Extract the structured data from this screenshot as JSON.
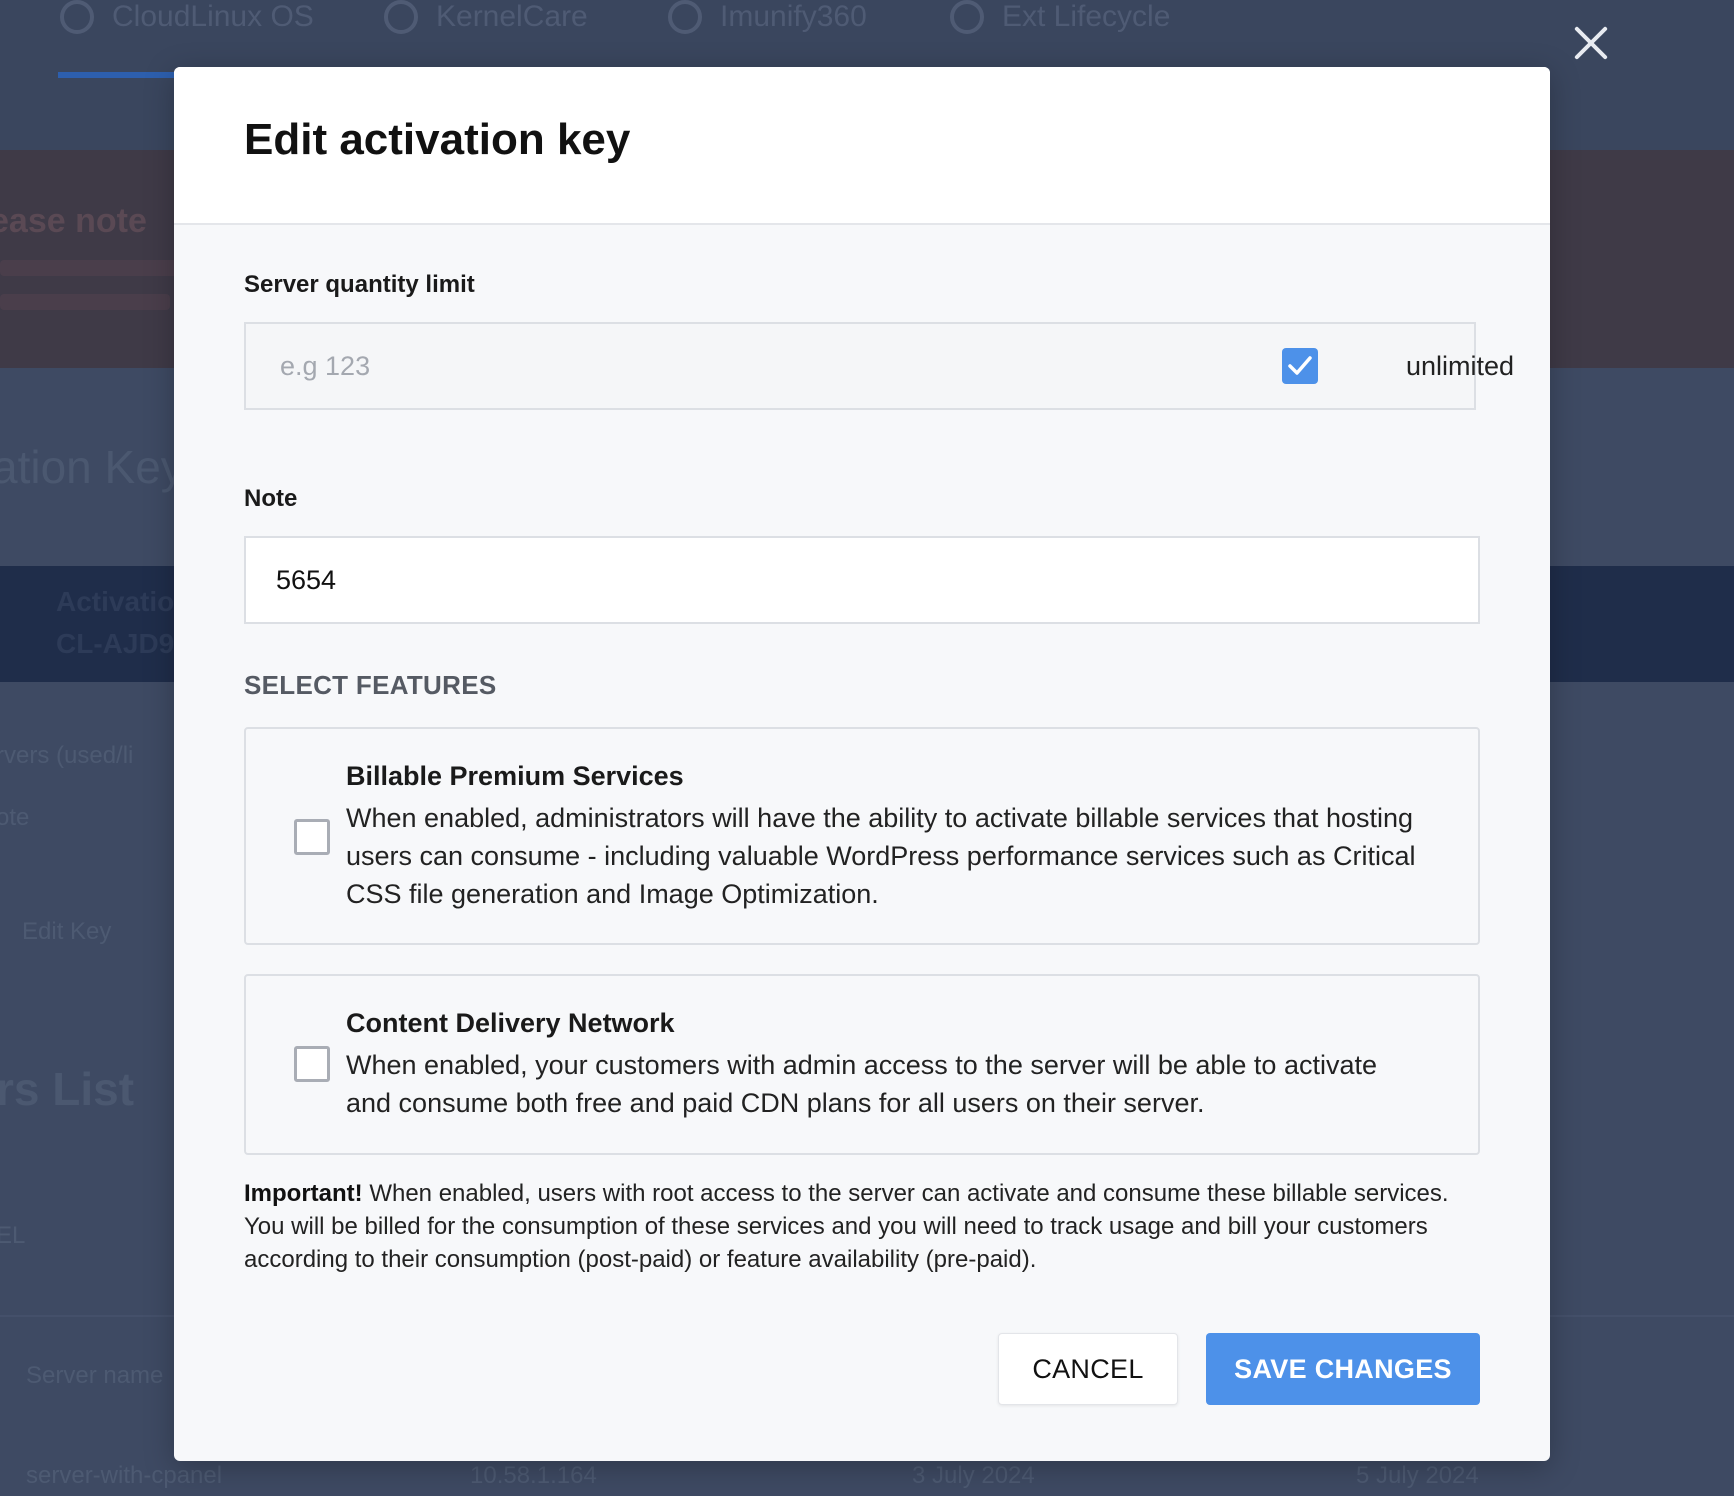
{
  "background": {
    "tabs": [
      "CloudLinux OS",
      "KernelCare",
      "Imunify360",
      "Ext Lifecycle"
    ],
    "notice_title": "ease note",
    "heading_keys": "ation Key",
    "keybar_label": "Activatio",
    "keybar_value": "CL-AJD9",
    "servers_used": "rvers (used/li",
    "note_label": "ote",
    "edit_key": "Edit Key",
    "servers_list_heading": "rs List",
    "filter_text": "EL",
    "server_name_header": "Server name",
    "row": {
      "server": "server-with-cpanel",
      "ip": "10.58.1.164",
      "created": "3 July 2024",
      "updated": "5 July 2024"
    }
  },
  "modal": {
    "title": "Edit activation key",
    "server_quantity": {
      "label": "Server quantity limit",
      "placeholder": "e.g 123",
      "value": "",
      "unlimited_label": "unlimited",
      "unlimited_checked": true
    },
    "note": {
      "label": "Note",
      "value": "5654"
    },
    "features_title": "SELECT FEATURES",
    "features": [
      {
        "title": "Billable Premium Services",
        "description": "When enabled, administrators will have the ability to activate billable services that hosting users can consume - including valuable WordPress performance services such as Critical CSS file generation and Image Optimization.",
        "checked": false
      },
      {
        "title": "Content Delivery Network",
        "description": "When enabled, your customers with admin access to the server will be able to activate and consume both free and paid CDN plans for all users on their server.",
        "checked": false
      }
    ],
    "important_label": "Important!",
    "important_text": " When enabled, users with root access to the server can activate and consume these billable services. You will be billed for the consumption of these services and you will need to track usage and bill your customers according to their consumption (post-paid) or feature availability (pre-paid).",
    "cancel_label": "CANCEL",
    "save_label": "SAVE CHANGES"
  },
  "icons": {
    "close": "close-icon",
    "check": "check-icon"
  },
  "colors": {
    "accent": "#4d91e9",
    "overlay": "#3e4a63"
  }
}
